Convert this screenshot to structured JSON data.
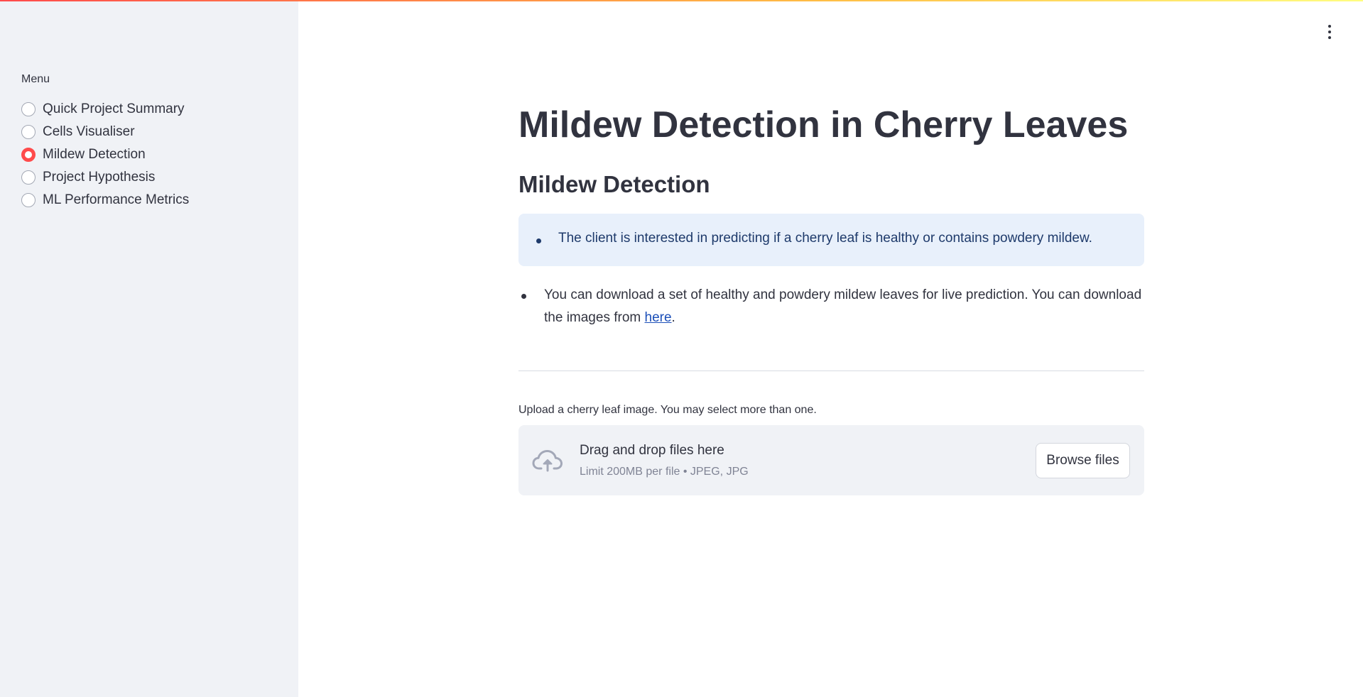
{
  "sidebar": {
    "menu_label": "Menu",
    "items": [
      {
        "label": "Quick Project Summary",
        "selected": false
      },
      {
        "label": "Cells Visualiser",
        "selected": false
      },
      {
        "label": "Mildew Detection",
        "selected": true
      },
      {
        "label": "Project Hypothesis",
        "selected": false
      },
      {
        "label": "ML Performance Metrics",
        "selected": false
      }
    ]
  },
  "main": {
    "title": "Mildew Detection in Cherry Leaves",
    "subheader": "Mildew Detection",
    "info_text": "The client is interested in predicting if a cherry leaf is healthy or contains powdery mildew.",
    "bullet_text": "You can download a set of healthy and powdery mildew leaves for live prediction. You can download the images from ",
    "bullet_link": "here",
    "bullet_end": "."
  },
  "uploader": {
    "label": "Upload a cherry leaf image. You may select more than one.",
    "drop_title": "Drag and drop files here",
    "drop_limit": "Limit 200MB per file • JPEG, JPG",
    "browse_label": "Browse files"
  },
  "icons": {
    "upload": "cloud-upload-icon",
    "menu": "kebab-menu-icon"
  },
  "colors": {
    "accent": "#ff4b4b",
    "sidebar_bg": "#f0f2f6",
    "info_bg": "#e8f0fb",
    "text": "#31333F",
    "link": "#1c4fb8"
  }
}
